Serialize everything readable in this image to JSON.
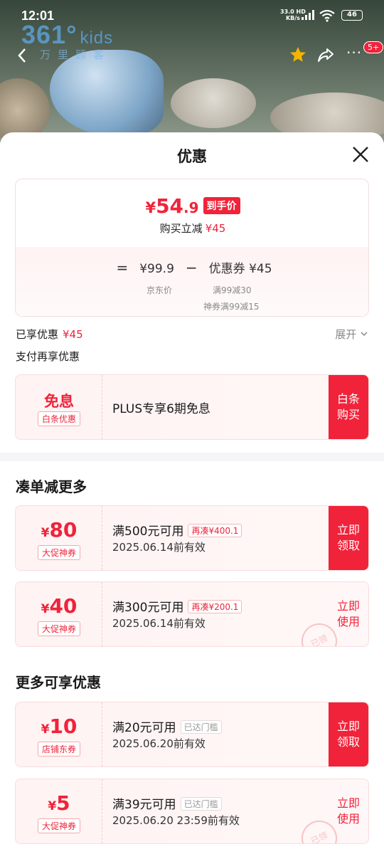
{
  "status_bar": {
    "time": "12:01",
    "net_speed_value": "33.0",
    "net_speed_unit": "KB/s",
    "network": "HD",
    "battery": "46"
  },
  "background": {
    "brand": "361°",
    "brand_kids": "kids",
    "brand_sub": "万里顾客",
    "more_badge": "5+"
  },
  "sheet": {
    "title": "优惠"
  },
  "price_card": {
    "yen": "¥",
    "price_int": "54",
    "price_dec": ".9",
    "final_tag": "到手价",
    "reduce_label": "购买立减",
    "reduce_value": "¥45",
    "eq": "=",
    "jd_price": "¥99.9",
    "minus": "−",
    "coupon_text": "优惠券 ¥45",
    "jd_price_label": "京东价",
    "coupon_sub1": "满99减30",
    "coupon_sub2": "神券满99减15"
  },
  "enjoyed": {
    "label": "已享优惠",
    "value": "¥45",
    "expand": "展开"
  },
  "pay_more": "支付再享优惠",
  "plus_offer": {
    "title": "免息",
    "type": "白条优惠",
    "desc": "PLUS专享6期免息",
    "action_line1": "白条",
    "action_line2": "购买"
  },
  "section1_title": "凑单减更多",
  "section2_title": "更多可享优惠",
  "coupons": [
    {
      "yen": "¥",
      "amount": "80",
      "type": "大促神券",
      "cond": "满500元可用",
      "tag": "再凑¥400.1",
      "valid": "2025.06.14前有效",
      "action_line1": "立即",
      "action_line2": "领取"
    },
    {
      "yen": "¥",
      "amount": "40",
      "type": "大促神券",
      "cond": "满300元可用",
      "tag": "再凑¥200.1",
      "valid": "2025.06.14前有效",
      "action_line1": "立即",
      "action_line2": "使用",
      "stamp": "已领"
    },
    {
      "yen": "¥",
      "amount": "10",
      "type": "店铺东券",
      "cond": "满20元可用",
      "tag": "已达门槛",
      "valid": "2025.06.20前有效",
      "action_line1": "立即",
      "action_line2": "领取"
    },
    {
      "yen": "¥",
      "amount": "5",
      "type": "大促神券",
      "cond": "满39元可用",
      "tag": "已达门槛",
      "valid": "2025.06.20 23:59前有效",
      "action_line1": "立即",
      "action_line2": "使用",
      "stamp": "已领"
    }
  ],
  "colors": {
    "accent": "#f0233a",
    "card_bg": "#fff3f3",
    "divider": "#f5f5f7"
  },
  "icons": {
    "back": "chevron-left-icon",
    "favorite": "star-icon",
    "share": "share-icon",
    "more": "more-dots-icon",
    "close": "close-icon",
    "expand": "chevron-down-icon"
  }
}
